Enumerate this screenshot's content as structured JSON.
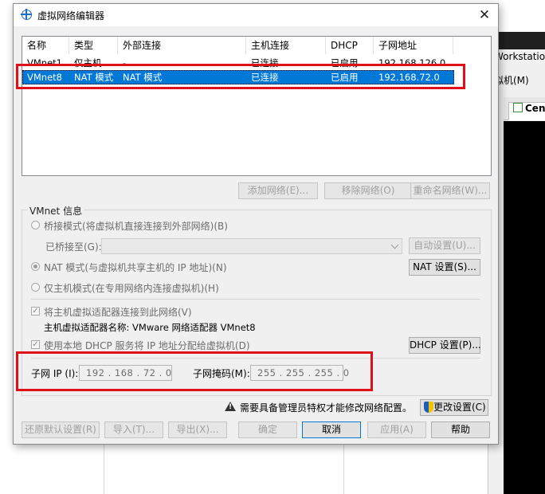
{
  "background_app": {
    "title_fragment": "Workstatio",
    "menu_fragment": "拟机(M)",
    "tab_label": "Cen"
  },
  "dialog": {
    "title": "虚拟网络编辑器",
    "close_glyph": "✕"
  },
  "network_table": {
    "columns": [
      "名称",
      "类型",
      "外部连接",
      "主机连接",
      "DHCP",
      "子网地址"
    ],
    "rows": [
      {
        "name": "VMnet1",
        "type": "仅主机...",
        "external": "-",
        "host": "已连接",
        "dhcp": "已启用",
        "subnet": "192.168.126.0",
        "selected": false
      },
      {
        "name": "VMnet8",
        "type": "NAT 模式",
        "external": "NAT 模式",
        "host": "已连接",
        "dhcp": "已启用",
        "subnet": "192.168.72.0",
        "selected": true
      }
    ]
  },
  "table_buttons": {
    "add": "添加网络(E)...",
    "remove": "移除网络(O)",
    "rename": "重命名网络(W)..."
  },
  "vmnet_info": {
    "group_label": "VMnet 信息",
    "bridged_mode": "桥接模式(将虚拟机直接连接到外部网络)(B)",
    "bridged_to_label": "已桥接至(G):",
    "bridged_to_value": "",
    "auto_settings": "自动设置(U)...",
    "nat_mode": "NAT 模式(与虚拟机共享主机的 IP 地址)(N)",
    "nat_settings": "NAT 设置(S)...",
    "host_only_mode": "仅主机模式(在专用网络内连接虚拟机)(H)",
    "connect_adapter": "将主机虚拟适配器连接到此网络(V)",
    "adapter_name": "主机虚拟适配器名称: VMware 网络适配器 VMnet8",
    "use_dhcp": "使用本地 DHCP 服务将 IP 地址分配给虚拟机(D)",
    "dhcp_settings": "DHCP 设置(P)...",
    "subnet_ip_label": "子网 IP (I):",
    "subnet_ip_value": "192 . 168 . 72 . 0",
    "subnet_mask_label": "子网掩码(M):",
    "subnet_mask_value": "255 . 255 . 255 . 0"
  },
  "admin_notice": {
    "text": "需要具备管理员特权才能修改网络配置。",
    "change_settings": "更改设置(C)"
  },
  "bottom_buttons": {
    "restore": "还原默认设置(R)",
    "import": "导入(T)...",
    "export": "导出(X)...",
    "ok": "确定",
    "cancel": "取消",
    "apply": "应用(A)",
    "help": "帮助"
  }
}
